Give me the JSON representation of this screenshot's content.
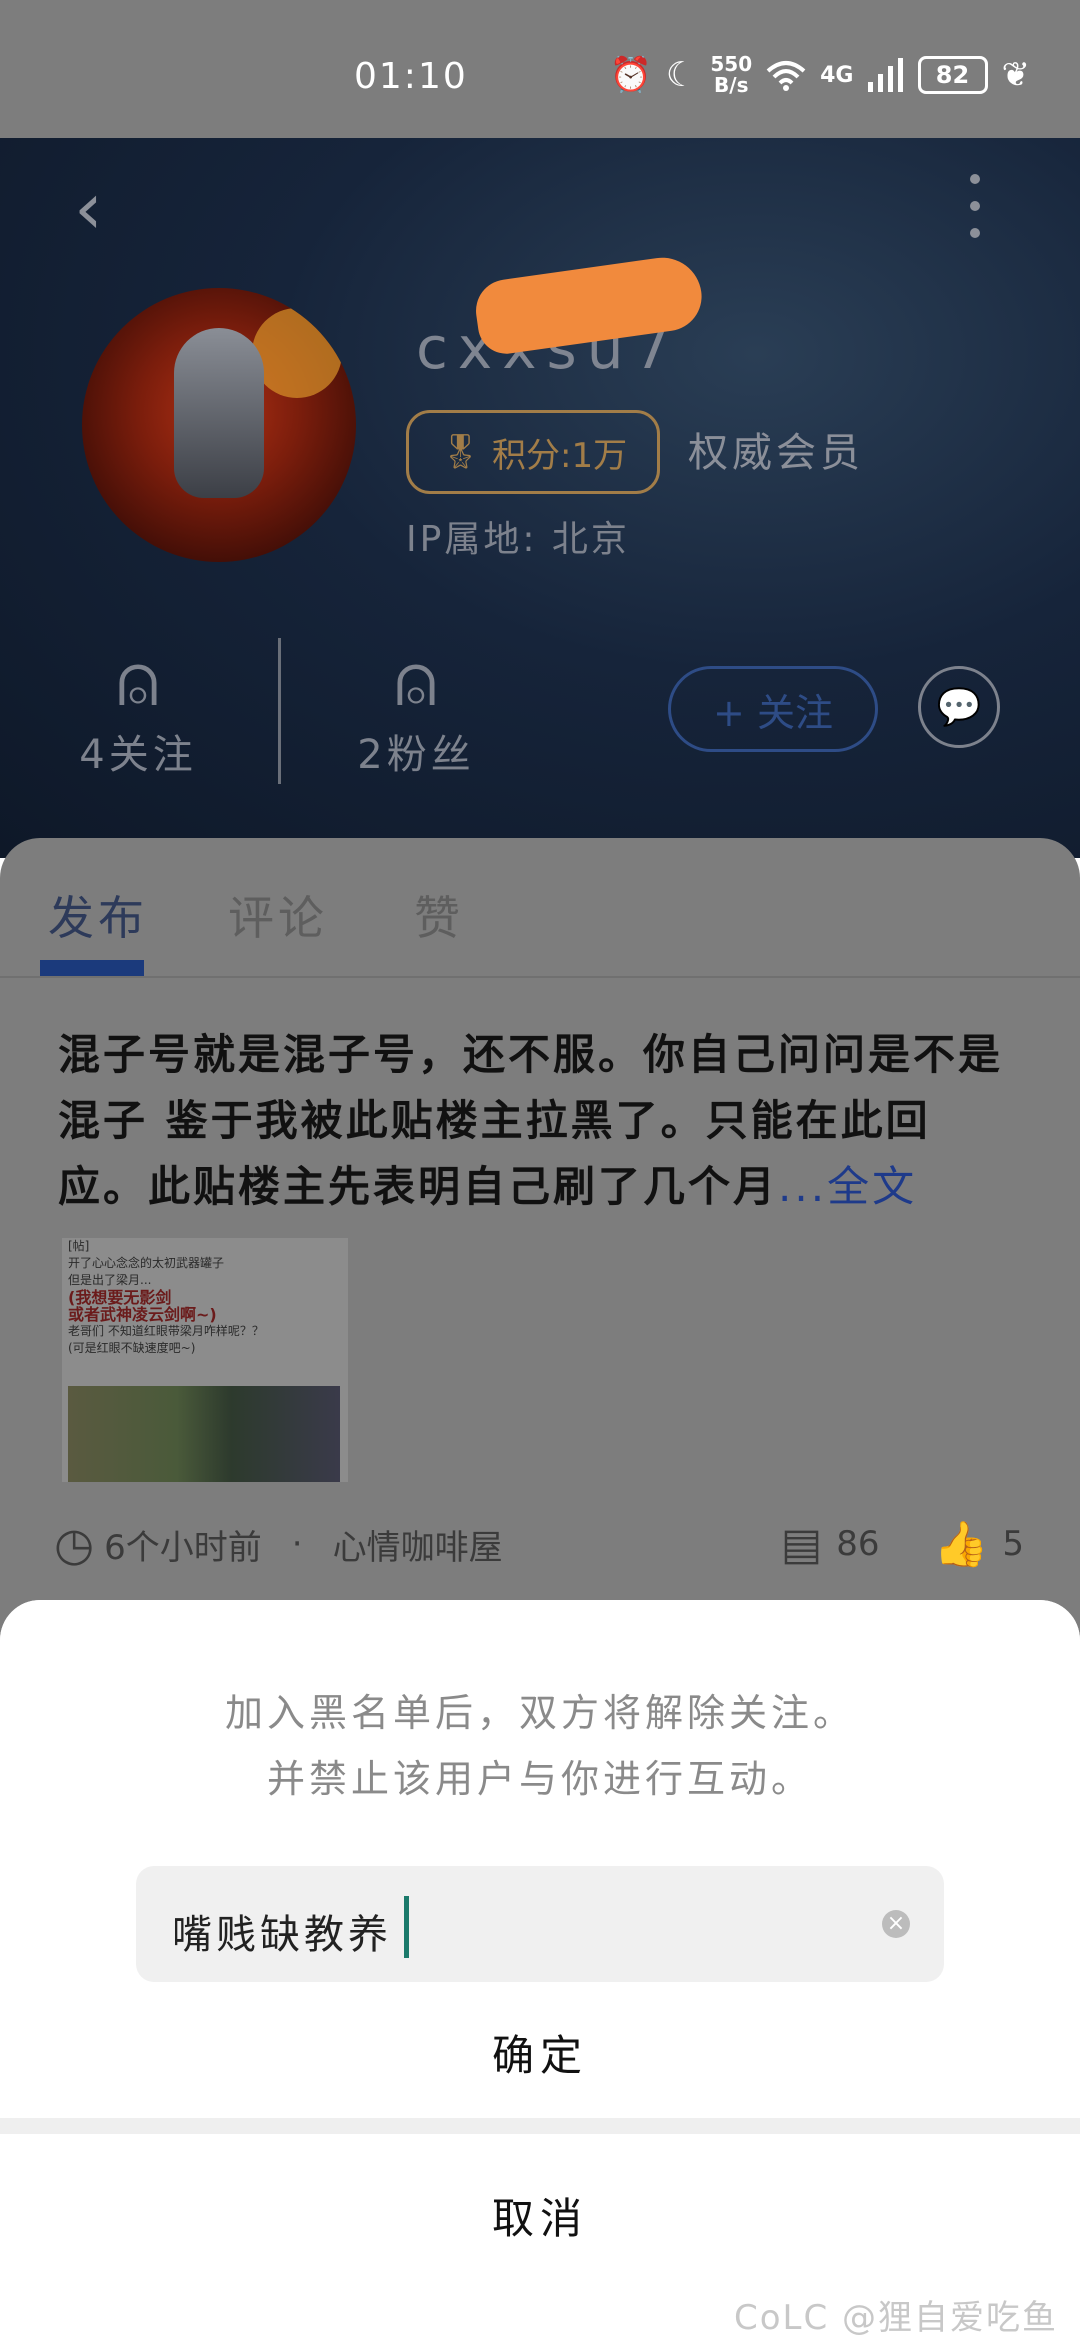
{
  "status_bar": {
    "time": "01:10",
    "speed_value": "550",
    "speed_unit": "B/s",
    "network": "4G",
    "battery": "82",
    "icons": [
      "alarm-icon",
      "moon-icon",
      "wifi-icon",
      "signal-icon",
      "battery-icon",
      "leaf-icon"
    ]
  },
  "profile": {
    "username": "cxxsu7",
    "points_label": "积分:1万",
    "member_label": "权威会员",
    "ip_label": "IP属地: 北京",
    "following_label": "4关注",
    "followers_label": "2粉丝",
    "follow_button": "+ 关注"
  },
  "tabs": [
    "发布",
    "评论",
    "赞"
  ],
  "active_tab": "发布",
  "post": {
    "text": "混子号就是混子号，还不服。你自己问问是不是混子    鉴于我被此贴楼主拉黑了。只能在此回应。此贴楼主先表明自己刷了几个月",
    "more_label": "...全文",
    "image_lines": [
      "[帖]",
      "开了心心念念的太初武器罐子",
      "但是出了梁月...",
      "(我想要无影剑",
      "或者武神凌云剑啊~)",
      "老哥们 不知道红眼带梁月咋样呢？？",
      "(可是红眼不缺速度吧~)"
    ],
    "time_ago": "6个小时前",
    "separator": "·",
    "forum": "心情咖啡屋",
    "comments": "86",
    "likes": "5"
  },
  "dialog": {
    "message_line1": "加入黑名单后，双方将解除关注。",
    "message_line2": "并禁止该用户与你进行互动。",
    "input_value": "嘴贱缺教养",
    "confirm_label": "确定",
    "cancel_label": "取消"
  },
  "watermark": "CoLC @狸自爱吃鱼"
}
